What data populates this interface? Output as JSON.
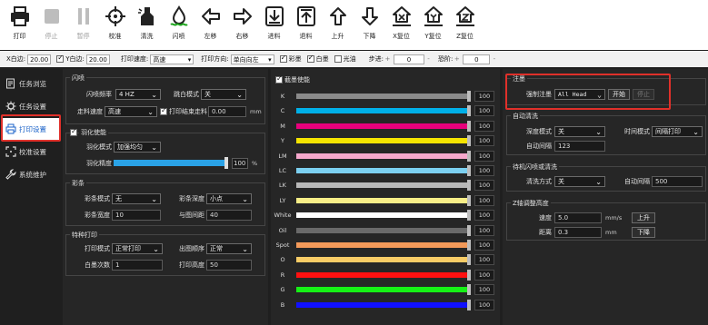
{
  "toolbar": {
    "items": [
      {
        "label": "打印",
        "icon": "printer-icon",
        "enabled": true
      },
      {
        "label": "停止",
        "icon": "stop-icon",
        "enabled": false
      },
      {
        "label": "暂停",
        "icon": "pause-icon",
        "enabled": false
      },
      {
        "label": "校准",
        "icon": "crosshair-icon",
        "enabled": true
      },
      {
        "label": "清洗",
        "icon": "clean-icon",
        "enabled": true
      },
      {
        "label": "闪喷",
        "icon": "flash-spray-icon",
        "enabled": true
      },
      {
        "label": "左移",
        "icon": "arrow-left-icon",
        "enabled": true
      },
      {
        "label": "右移",
        "icon": "arrow-right-icon",
        "enabled": true
      },
      {
        "label": "进料",
        "icon": "feed-in-icon",
        "enabled": true
      },
      {
        "label": "退料",
        "icon": "feed-out-icon",
        "enabled": true
      },
      {
        "label": "上升",
        "icon": "arrow-up-icon",
        "enabled": true
      },
      {
        "label": "下降",
        "icon": "arrow-down-icon",
        "enabled": true
      },
      {
        "label": "X复位",
        "icon": "x-home-icon",
        "enabled": true
      },
      {
        "label": "Y复位",
        "icon": "y-home-icon",
        "enabled": true
      },
      {
        "label": "Z复位",
        "icon": "z-home-icon",
        "enabled": true
      }
    ]
  },
  "params": {
    "x_margin_label": "X白边:",
    "x_margin_value": "20.00",
    "y_margin_check": "Y白边:",
    "y_margin_value": "20.00",
    "speed_label": "打印速度:",
    "speed_value": "高速",
    "direction_label": "打印方向:",
    "direction_value": "单向向左",
    "color_check": "彩墨",
    "white_check": "白墨",
    "varnish_check": "光油",
    "step_label": "步进:",
    "step_value": "0",
    "offset_label": "恐阶:",
    "offset_value": "0"
  },
  "sidebar": {
    "items": [
      {
        "label": "任务浏览",
        "icon": "task-browse-icon"
      },
      {
        "label": "任务设置",
        "icon": "task-settings-icon"
      },
      {
        "label": "打印设置",
        "icon": "print-settings-icon"
      },
      {
        "label": "校准设置",
        "icon": "calibration-settings-icon"
      },
      {
        "label": "系统维护",
        "icon": "maintenance-wrench-icon"
      }
    ],
    "active_index": 2
  },
  "left_panel": {
    "flash": {
      "title": "闪喷",
      "freq_label": "闪喷频率",
      "freq_value": "4 HZ",
      "jump_label": "跳白模式",
      "jump_value": "关",
      "feed_speed_label": "走料速度",
      "feed_speed_value": "高速",
      "after_print_label": "打印结束走料",
      "after_print_value": "0.00",
      "after_print_unit": "mm"
    },
    "feather": {
      "enable_label": "羽化使能",
      "mode_label": "羽化模式",
      "mode_value": "加强均匀",
      "precision_label": "羽化精度",
      "precision_value": "100",
      "precision_unit": "%",
      "precision_fraction": 1.0
    },
    "strip": {
      "title": "彩条",
      "mode_label": "彩条模式",
      "mode_value": "无",
      "depth_label": "彩条深度",
      "depth_value": "小点",
      "width_label": "彩条宽度",
      "width_value": "10",
      "gap_label": "与图间距",
      "gap_value": "40"
    },
    "special": {
      "title": "特种打印",
      "mode_label": "打印模式",
      "mode_value": "正常打印",
      "order_label": "出图顺序",
      "order_value": "正常",
      "white_times_label": "白墨次数",
      "white_times_value": "1",
      "height_label": "打印高度",
      "height_value": "50"
    }
  },
  "ink_panel": {
    "enable_label": "截墨使能",
    "channels": [
      {
        "name": "K",
        "color": "#8a8a8a",
        "value": "100"
      },
      {
        "name": "C",
        "color": "#00b0e8",
        "value": "100"
      },
      {
        "name": "M",
        "color": "#e8007c",
        "value": "100"
      },
      {
        "name": "Y",
        "color": "#f5e400",
        "value": "100"
      },
      {
        "name": "LM",
        "color": "#f6a8cc",
        "value": "100"
      },
      {
        "name": "LC",
        "color": "#7cd0f0",
        "value": "100"
      },
      {
        "name": "LK",
        "color": "#b8b8b8",
        "value": "100"
      },
      {
        "name": "LY",
        "color": "#f8ee88",
        "value": "100"
      },
      {
        "name": "White",
        "color": "#ffffff",
        "value": "100"
      },
      {
        "name": "Oil",
        "color": "#6a6a6a",
        "value": "100"
      },
      {
        "name": "Spot",
        "color": "#f39a5a",
        "value": "100"
      },
      {
        "name": "O",
        "color": "#f8cc66",
        "value": "100"
      },
      {
        "name": "R",
        "color": "#ff1010",
        "value": "100"
      },
      {
        "name": "G",
        "color": "#16f016",
        "value": "100"
      },
      {
        "name": "B",
        "color": "#1010ff",
        "value": "100"
      }
    ]
  },
  "right_panel": {
    "forced_flash": {
      "title": "注墨",
      "label": "强制注墨",
      "value": "All Head",
      "start_label": "开始",
      "stop_label": "停止"
    },
    "auto_clean": {
      "title": "自动清洗",
      "depth_label": "深度模式",
      "depth_value": "关",
      "time_label": "时间模式",
      "time_value": "间隔打印",
      "interval_label": "自动间隔",
      "interval_value": "123"
    },
    "standby": {
      "title": "待机闪喷或清洗",
      "mode_label": "清洗方式",
      "mode_value": "关",
      "interval_label": "自动间隔",
      "interval_value": "500"
    },
    "z_axis": {
      "title": "Z轴调整高度",
      "speed_label": "速度",
      "speed_value": "5.0",
      "speed_unit": "mm/s",
      "up_label": "上升",
      "distance_label": "距离",
      "distance_value": "0.3",
      "distance_unit": "mm",
      "down_label": "下降"
    }
  },
  "colors": {
    "accent_active": "#1a62c8",
    "highlight_box": "#e0302a",
    "slider_fill": "#2aa2e6"
  }
}
